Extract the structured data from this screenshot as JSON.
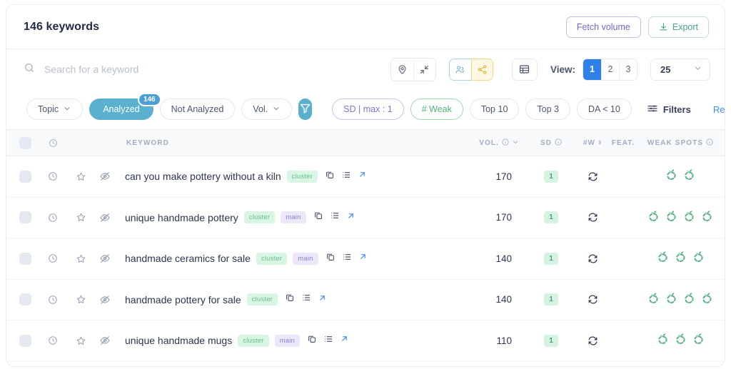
{
  "header": {
    "title": "146 keywords",
    "fetch_volume_label": "Fetch volume",
    "export_label": "Export"
  },
  "search": {
    "placeholder": "Search for a keyword"
  },
  "toolbar": {
    "view_label": "View:",
    "view_options": [
      "1",
      "2",
      "3"
    ],
    "view_selected": "1",
    "per_page": "25"
  },
  "filters": {
    "topic": "Topic",
    "analyzed": "Analyzed",
    "analyzed_badge": "146",
    "not_analyzed": "Not Analyzed",
    "vol": "Vol.",
    "sd_max": "SD | max : 1",
    "weak": "# Weak",
    "top10": "Top 10",
    "top3": "Top 3",
    "da": "DA  < 10",
    "filters_label": "Filters",
    "reset_label": "Reset"
  },
  "table": {
    "columns": {
      "keyword": "KEYWORD",
      "vol": "VOL.",
      "sd": "SD",
      "w": "#W",
      "w_sup": "3",
      "feat": "FEAT.",
      "weak_spots": "WEAK SPOTS"
    },
    "rows": [
      {
        "keyword": "can you make pottery without a kiln",
        "tags": [
          "cluster"
        ],
        "vol": "170",
        "sd": "1",
        "weak_spots": 2
      },
      {
        "keyword": "unique handmade pottery",
        "tags": [
          "cluster",
          "main"
        ],
        "vol": "170",
        "sd": "1",
        "weak_spots": 4
      },
      {
        "keyword": "handmade ceramics for sale",
        "tags": [
          "cluster",
          "main"
        ],
        "vol": "140",
        "sd": "1",
        "weak_spots": 3
      },
      {
        "keyword": "handmade pottery for sale",
        "tags": [
          "cluster"
        ],
        "vol": "140",
        "sd": "1",
        "weak_spots": 4
      },
      {
        "keyword": "unique handmade mugs",
        "tags": [
          "cluster",
          "main"
        ],
        "vol": "110",
        "sd": "1",
        "weak_spots": 3
      }
    ]
  },
  "colors": {
    "accent_blue": "#2f7fe8",
    "teal": "#5bb0cd",
    "green": "#4cb37a",
    "purple": "#8272cd",
    "weak_spot_green": "#5cb487"
  }
}
